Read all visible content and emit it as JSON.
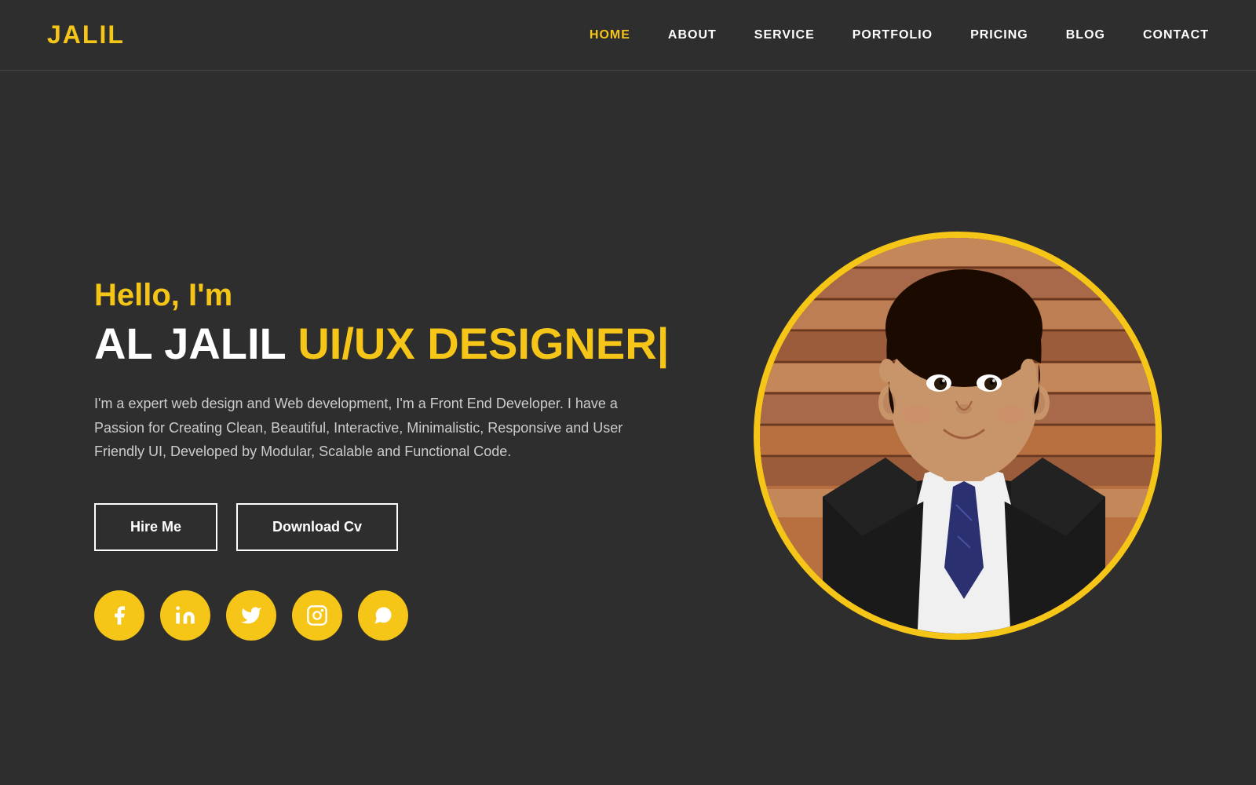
{
  "brand": {
    "logo": "JALIL"
  },
  "nav": {
    "links": [
      {
        "id": "home",
        "label": "HOME",
        "active": true
      },
      {
        "id": "about",
        "label": "ABOUT",
        "active": false
      },
      {
        "id": "service",
        "label": "SERVICE",
        "active": false
      },
      {
        "id": "portfolio",
        "label": "PORTFOLIO",
        "active": false
      },
      {
        "id": "pricing",
        "label": "PRICING",
        "active": false
      },
      {
        "id": "blog",
        "label": "BLOG",
        "active": false
      },
      {
        "id": "contact",
        "label": "CONTACT",
        "active": false
      }
    ]
  },
  "hero": {
    "greeting": "Hello, I'm",
    "name": "AL JALIL ",
    "title": "UI/UX DESIGNER|",
    "description": "I'm a expert web design and Web development, I'm a Front End Developer. I have a Passion for Creating Clean, Beautiful, Interactive, Minimalistic, Responsive and User Friendly UI, Developed by Modular, Scalable and Functional Code.",
    "buttons": {
      "hire": "Hire Me",
      "download": "Download Cv"
    },
    "social": {
      "facebook": "facebook-icon",
      "linkedin": "linkedin-icon",
      "twitter": "twitter-icon",
      "instagram": "instagram-icon",
      "whatsapp": "whatsapp-icon"
    }
  },
  "colors": {
    "accent": "#f5c518",
    "background": "#2e2e2e",
    "text_white": "#ffffff",
    "text_gray": "#cccccc"
  }
}
